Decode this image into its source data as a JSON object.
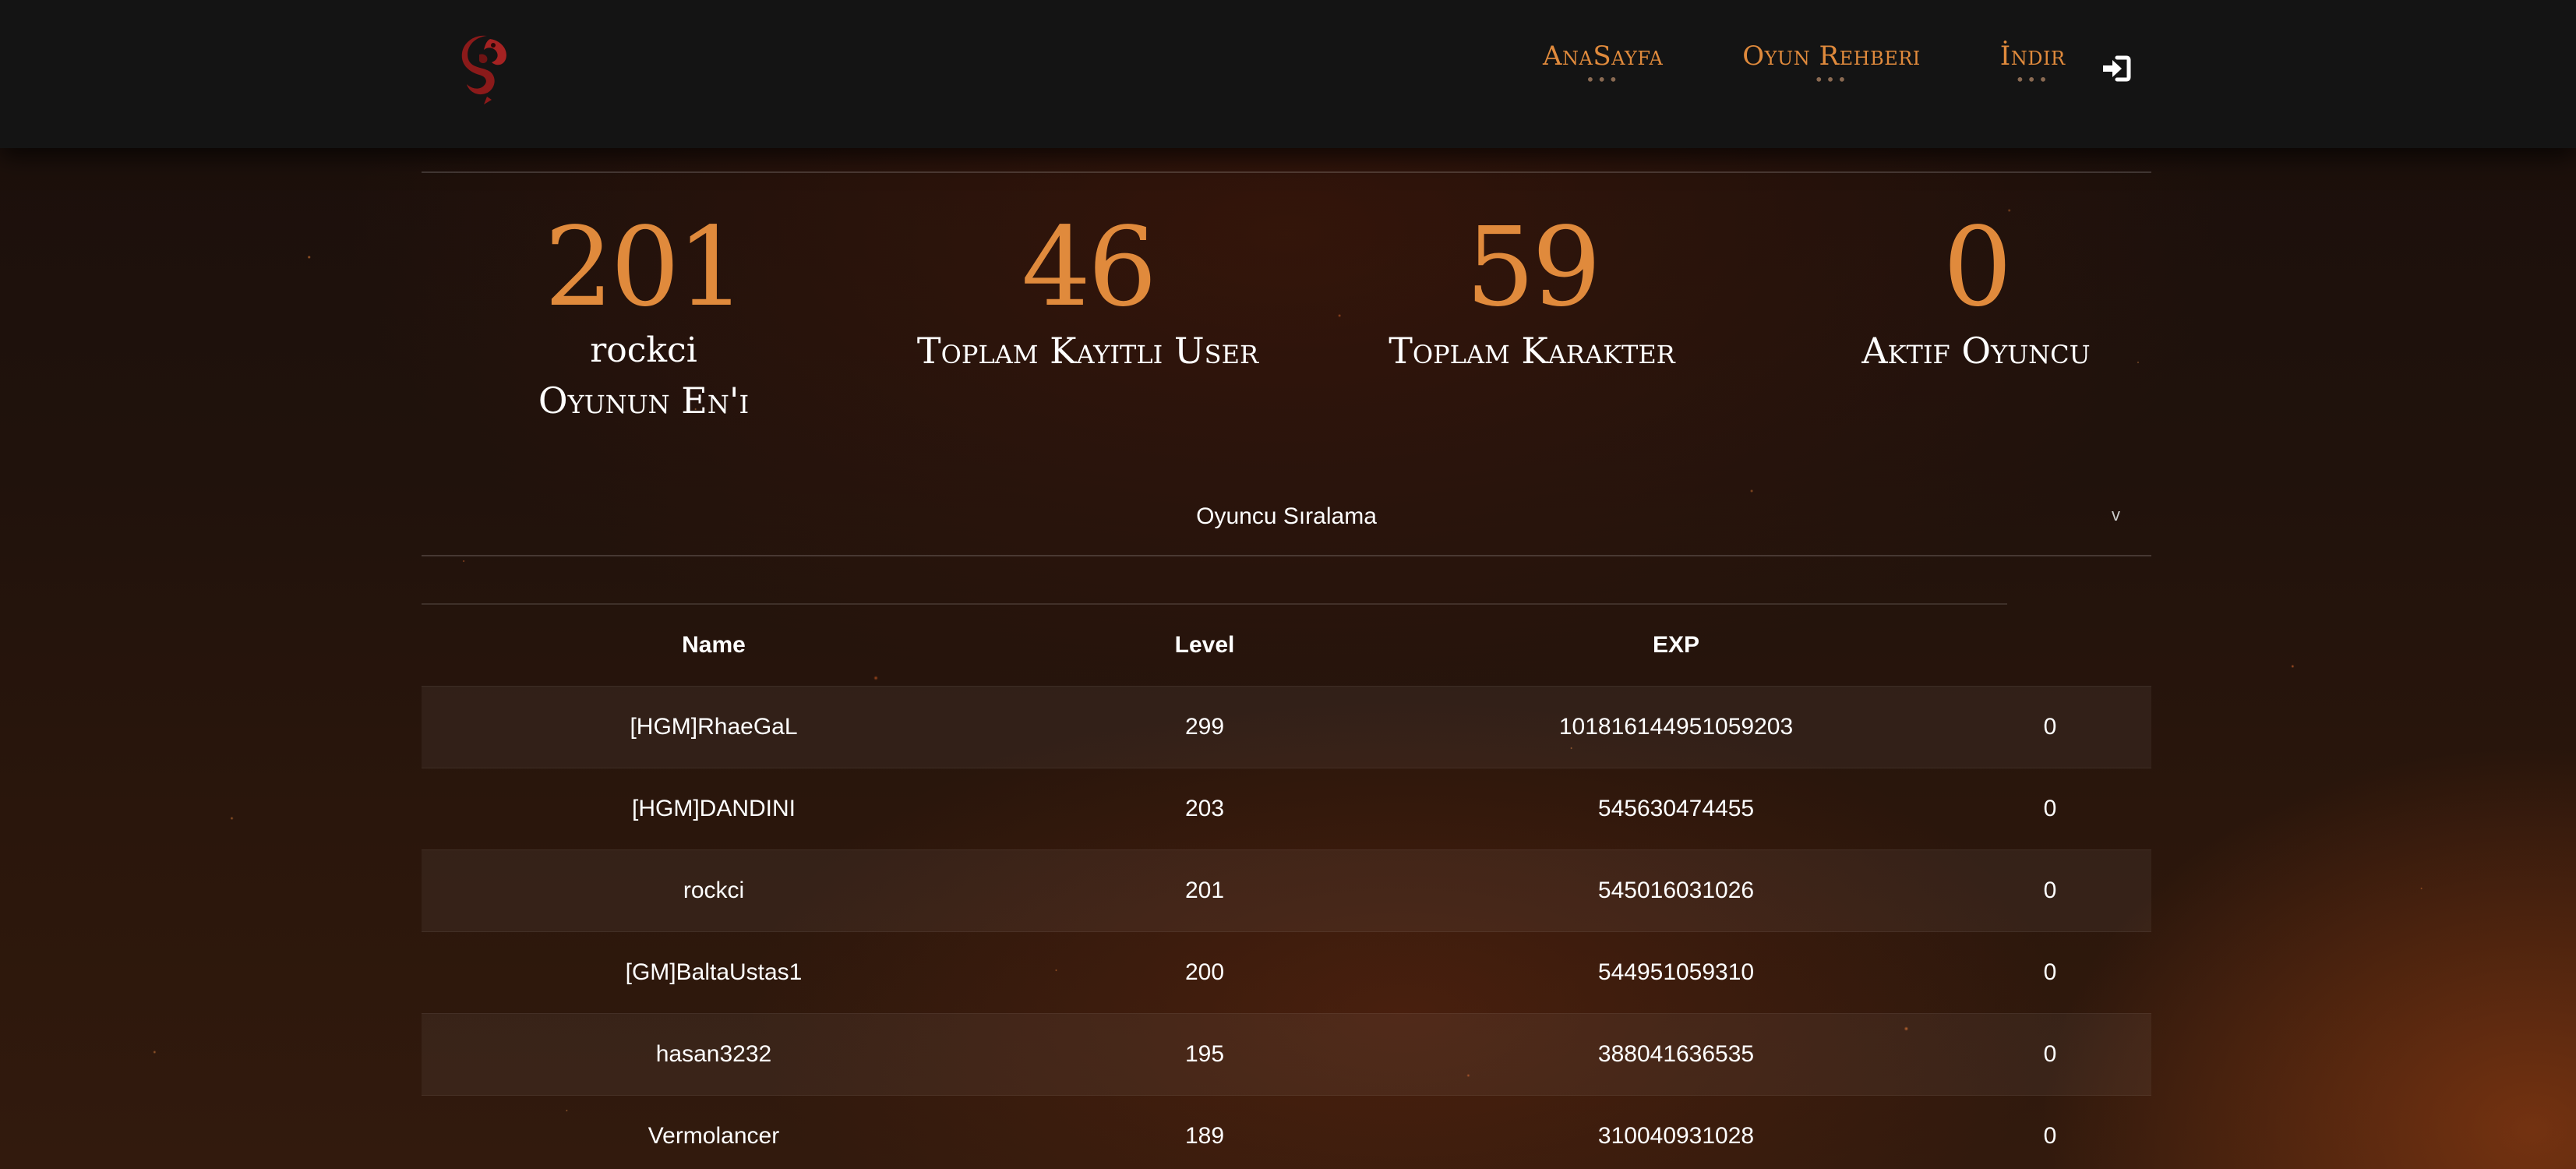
{
  "header": {
    "nav": [
      {
        "label": "AnaSayfa",
        "dots": "•••"
      },
      {
        "label": "Oyun Rehberi",
        "dots": "•••"
      },
      {
        "label": "İndir",
        "dots": "•••"
      }
    ],
    "login_icon": "sign-in-icon",
    "logo_icon": "dragon-logo-icon",
    "accent_color": "#e08a3c"
  },
  "stats": [
    {
      "number": "201",
      "label_line1": "rockci",
      "label_line2": "Oyunun En'i"
    },
    {
      "number": "46",
      "label_line1": "Toplam Kayıtlı User"
    },
    {
      "number": "59",
      "label_line1": "Toplam Karakter"
    },
    {
      "number": "0",
      "label_line1": "Aktif Oyuncu"
    }
  ],
  "ranking": {
    "dropdown_label": "Oyuncu Sıralama",
    "caret": "v",
    "columns": [
      "Name",
      "Level",
      "EXP"
    ],
    "rows": [
      {
        "name": "[HGM]RhaeGaL",
        "level": "299",
        "exp": "101816144951059203",
        "extra": "0"
      },
      {
        "name": "[HGM]DANDINI",
        "level": "203",
        "exp": "545630474455",
        "extra": "0"
      },
      {
        "name": "rockci",
        "level": "201",
        "exp": "545016031026",
        "extra": "0"
      },
      {
        "name": "[GM]BaltaUstas1",
        "level": "200",
        "exp": "544951059310",
        "extra": "0"
      },
      {
        "name": "hasan3232",
        "level": "195",
        "exp": "388041636535",
        "extra": "0"
      },
      {
        "name": "Vermolancer",
        "level": "189",
        "exp": "310040931028",
        "extra": "0"
      }
    ]
  }
}
